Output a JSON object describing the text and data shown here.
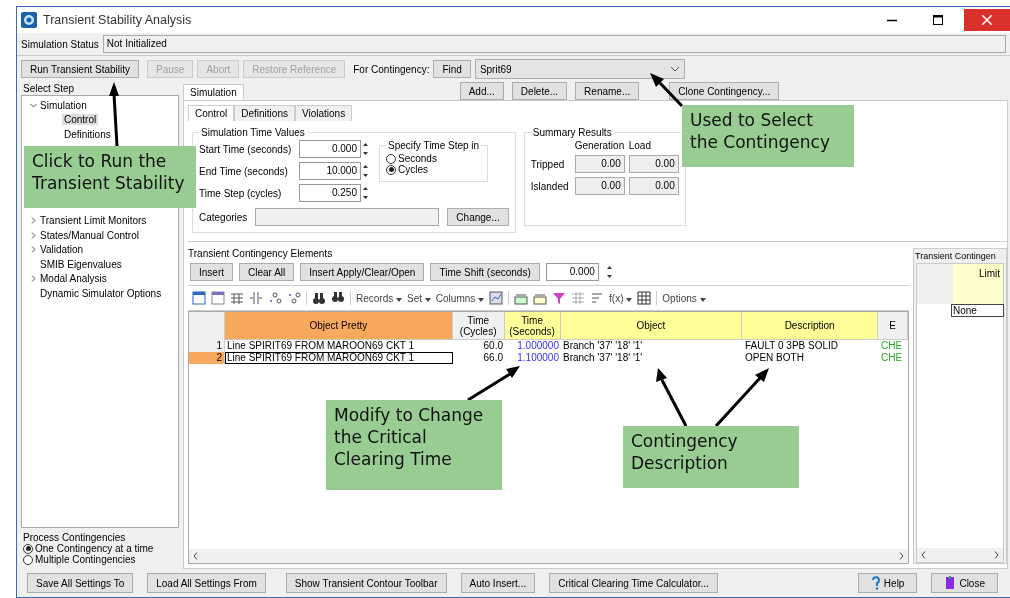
{
  "window": {
    "title": "Transient Stability Analysis"
  },
  "status": {
    "label": "Simulation Status",
    "value": "Not Initialized"
  },
  "actions": [
    {
      "label": "Run Transient Stability",
      "disabled": false
    },
    {
      "label": "Pause",
      "disabled": true
    },
    {
      "label": "Abort",
      "disabled": true
    },
    {
      "label": "Restore Reference",
      "disabled": true
    }
  ],
  "contingency": {
    "label": "For Contingency:",
    "find": "Find",
    "value": "Sprit69"
  },
  "select_step": {
    "title": "Select Step",
    "tree": [
      {
        "label": "Simulation",
        "expanded": true,
        "selected": false,
        "children": [
          {
            "label": "Control",
            "selected": true
          },
          {
            "label": "Definitions",
            "selected": false
          }
        ]
      },
      {
        "label": "Transient Limit Monitors",
        "expanded": false,
        "selected": false
      },
      {
        "label": "States/Manual Control",
        "expanded": false,
        "selected": false
      },
      {
        "label": "Validation",
        "expanded": false,
        "selected": false
      },
      {
        "label": "SMIB Eigenvalues",
        "selected": false
      },
      {
        "label": "Modal Analysis",
        "expanded": false,
        "selected": false
      },
      {
        "label": "Dynamic Simulator Options",
        "selected": false
      }
    ]
  },
  "process": {
    "title": "Process Contingencies",
    "options": [
      {
        "label": "One Contingency at a time",
        "selected": true
      },
      {
        "label": "Multiple Contingencies",
        "selected": false
      }
    ]
  },
  "top_tab": {
    "label": "Simulation",
    "selected": true
  },
  "contingency_buttons": [
    "Add...",
    "Delete...",
    "Rename...",
    "Clone Contingency..."
  ],
  "tabs": [
    {
      "label": "Control",
      "selected": true
    },
    {
      "label": "Definitions",
      "selected": false
    },
    {
      "label": "Violations",
      "selected": false
    }
  ],
  "time_values": {
    "title": "Simulation Time Values",
    "fields": [
      {
        "label": "Start Time (seconds)",
        "value": "0.000"
      },
      {
        "label": "End Time (seconds)",
        "value": "10.000"
      },
      {
        "label": "Time Step (cycles)",
        "value": "0.250"
      }
    ],
    "categories_label": "Categories",
    "change": "Change..."
  },
  "time_step": {
    "title": "Specify Time Step in",
    "options": [
      {
        "label": "Seconds",
        "selected": false
      },
      {
        "label": "Cycles",
        "selected": true
      }
    ]
  },
  "summary": {
    "title": "Summary Results",
    "columns": [
      "Generation",
      "Load"
    ],
    "rows": [
      {
        "label": "Tripped",
        "values": [
          "0.00",
          "0.00"
        ]
      },
      {
        "label": "Islanded",
        "values": [
          "0.00",
          "0.00"
        ]
      }
    ]
  },
  "elements": {
    "title": "Transient Contingency Elements",
    "buttons": [
      "Insert",
      "Clear All",
      "Insert Apply/Clear/Open",
      "Time Shift (seconds)"
    ],
    "shift": "0.000",
    "menus": [
      "Records",
      "Set",
      "Columns",
      "f(x)",
      "Options"
    ],
    "columns": [
      {
        "label": "Object Pretty",
        "kind": "key"
      },
      {
        "label": "Time (Cycles)",
        "kind": "plain"
      },
      {
        "label": "Time (Seconds)",
        "kind": "input"
      },
      {
        "label": "Object",
        "kind": "editable"
      },
      {
        "label": "Description",
        "kind": "editable"
      },
      {
        "label": "E",
        "kind": "status"
      }
    ],
    "rows": [
      {
        "number": "1",
        "selected": false,
        "cells": [
          "Line SPIRIT69 FROM MAROON69 CKT 1",
          "60.0",
          "1.000000",
          "Branch '37' '18' '1'",
          "FAULT 0 3PB SOLID",
          "CHE"
        ]
      },
      {
        "number": "2",
        "selected": true,
        "cells": [
          "Line SPIRIT69 FROM MAROON69 CKT 1",
          "66.0",
          "1.100000",
          "Branch '37' '18' '1'",
          "OPEN BOTH",
          "CHE"
        ]
      }
    ]
  },
  "side_panel": {
    "title": "Transient Contingen",
    "column": "Limit",
    "cell": "None"
  },
  "footer_buttons": [
    "Save All Settings To",
    "Load All Settings From",
    "Show Transient Contour Toolbar",
    "Auto Insert...",
    "Critical Clearing Time Calculator..."
  ],
  "help": "Help",
  "close": "Close",
  "callouts": [
    {
      "text": "Click to Run the Transient Stability"
    },
    {
      "text": "Used to Select the Contingency"
    },
    {
      "text": "Modify to Change the Critical Clearing Time"
    },
    {
      "text": "Contingency Description"
    }
  ]
}
